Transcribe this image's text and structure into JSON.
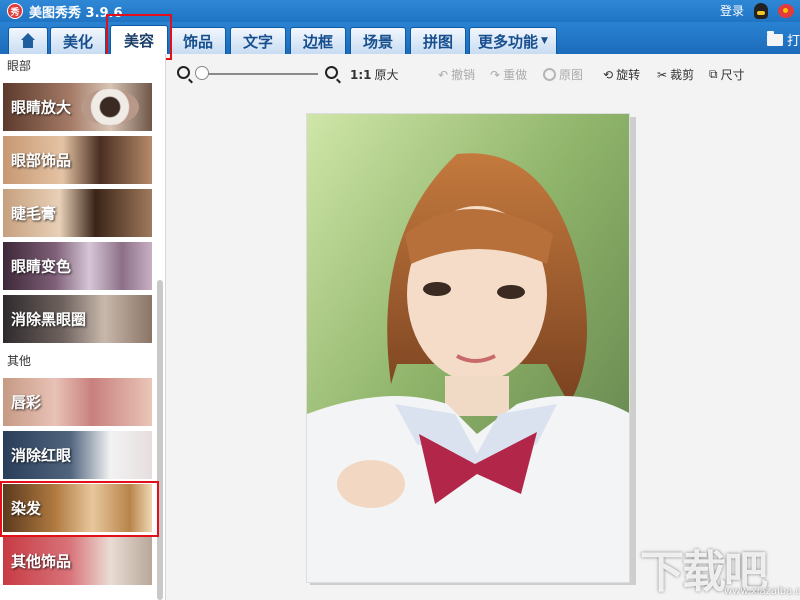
{
  "app": {
    "logo_text": "秀",
    "title": "美图秀秀 3.9.6",
    "login_label": "登录"
  },
  "tabs": [
    {
      "label": "美化"
    },
    {
      "label": "美容"
    },
    {
      "label": "饰品"
    },
    {
      "label": "文字"
    },
    {
      "label": "边框"
    },
    {
      "label": "场景"
    },
    {
      "label": "拼图"
    },
    {
      "label": "更多功能"
    }
  ],
  "open_label": "打",
  "sidebar": {
    "section_eye": "眼部",
    "eye_items": [
      {
        "label": "眼睛放大"
      },
      {
        "label": "眼部饰品"
      },
      {
        "label": "睫毛膏"
      },
      {
        "label": "眼睛变色"
      },
      {
        "label": "消除黑眼圈"
      }
    ],
    "section_other": "其他",
    "other_items": [
      {
        "label": "唇彩"
      },
      {
        "label": "消除红眼"
      },
      {
        "label": "染发"
      },
      {
        "label": "其他饰品"
      }
    ]
  },
  "toolbar": {
    "ratio_label": "1:1",
    "original_size": "原大",
    "undo": "撤销",
    "redo": "重做",
    "original": "原图",
    "rotate": "旋转",
    "crop": "裁剪",
    "size": "尺寸"
  },
  "watermark": {
    "text": "下载吧",
    "sub": "www.xiazaiba.com"
  },
  "colors": {
    "accent": "#1f74c4",
    "highlight": "#e3101a"
  }
}
